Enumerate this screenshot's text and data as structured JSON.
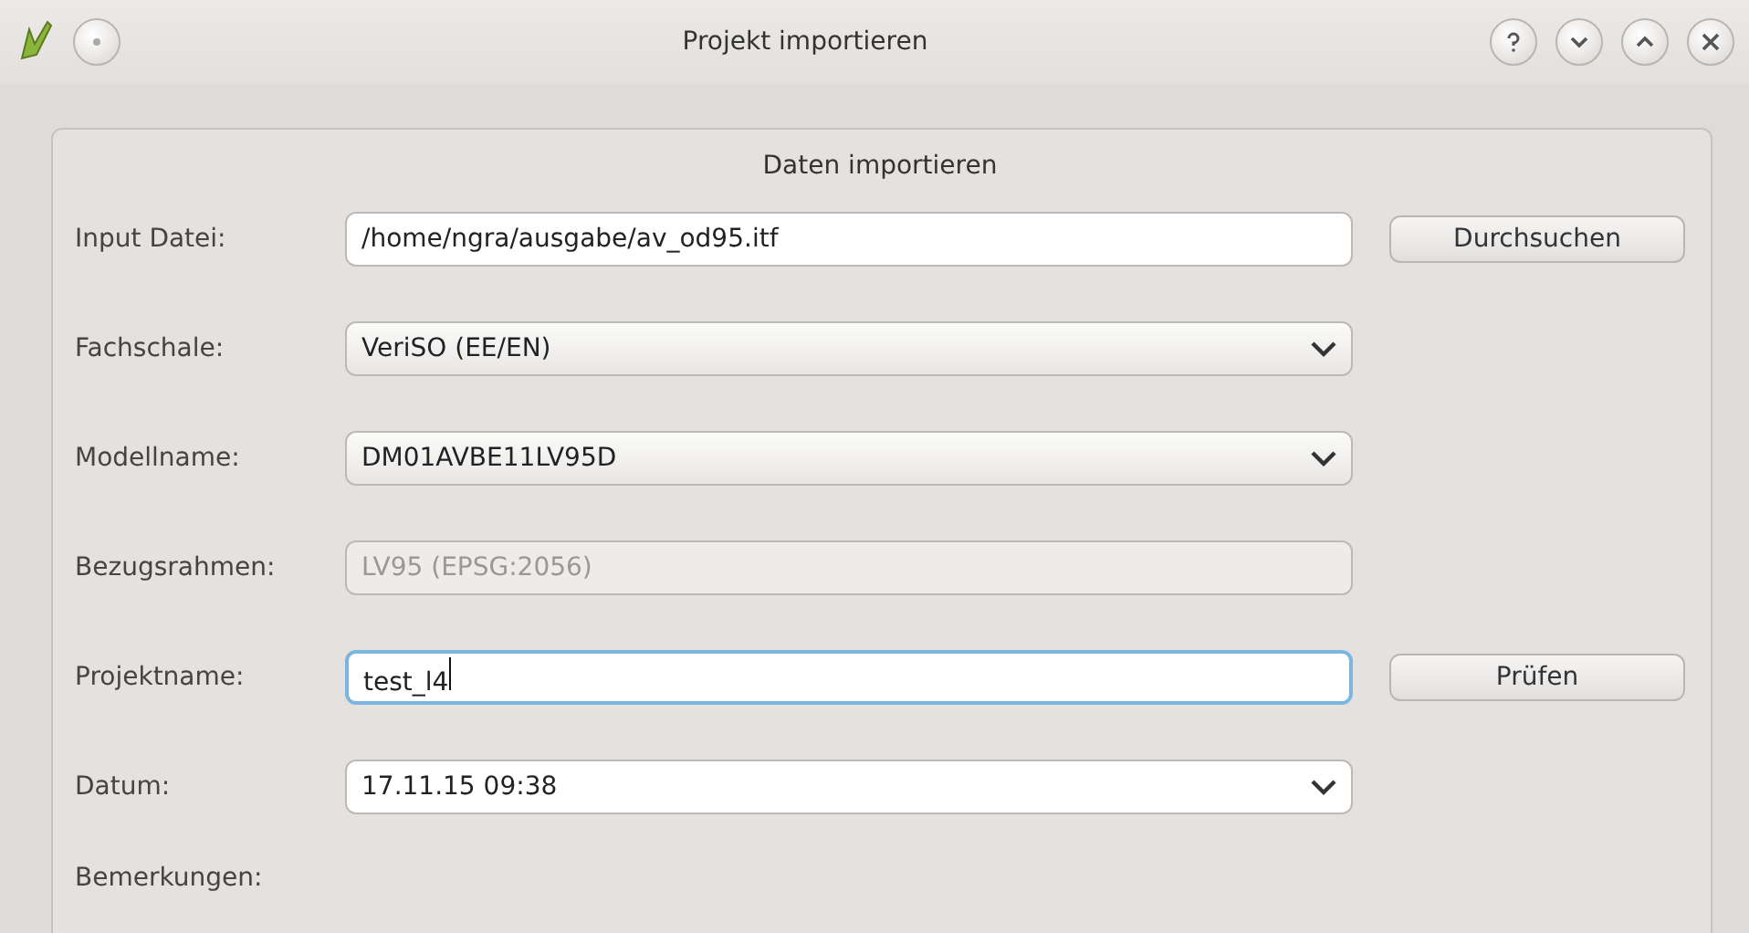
{
  "window": {
    "title": "Projekt importieren"
  },
  "group": {
    "title": "Daten importieren"
  },
  "rows": [
    {
      "label": "Input Datei:",
      "kind": "text",
      "value": "/home/ngra/ausgabe/av_od95.itf",
      "disabled": false,
      "focused": false,
      "button": "Durchsuchen"
    },
    {
      "label": "Fachschale:",
      "kind": "combo",
      "value": "VeriSO (EE/EN)",
      "editable": false
    },
    {
      "label": "Modellname:",
      "kind": "combo",
      "value": "DM01AVBE11LV95D",
      "editable": false
    },
    {
      "label": "Bezugsrahmen:",
      "kind": "text",
      "value": "LV95 (EPSG:2056)",
      "disabled": true,
      "focused": false
    },
    {
      "label": "Projektname:",
      "kind": "text",
      "value": "test_l4",
      "disabled": false,
      "focused": true,
      "button": "Prüfen"
    },
    {
      "label": "Datum:",
      "kind": "combo",
      "value": "17.11.15 09:38",
      "editable": true
    }
  ],
  "remarks": {
    "label": "Bemerkungen:"
  }
}
